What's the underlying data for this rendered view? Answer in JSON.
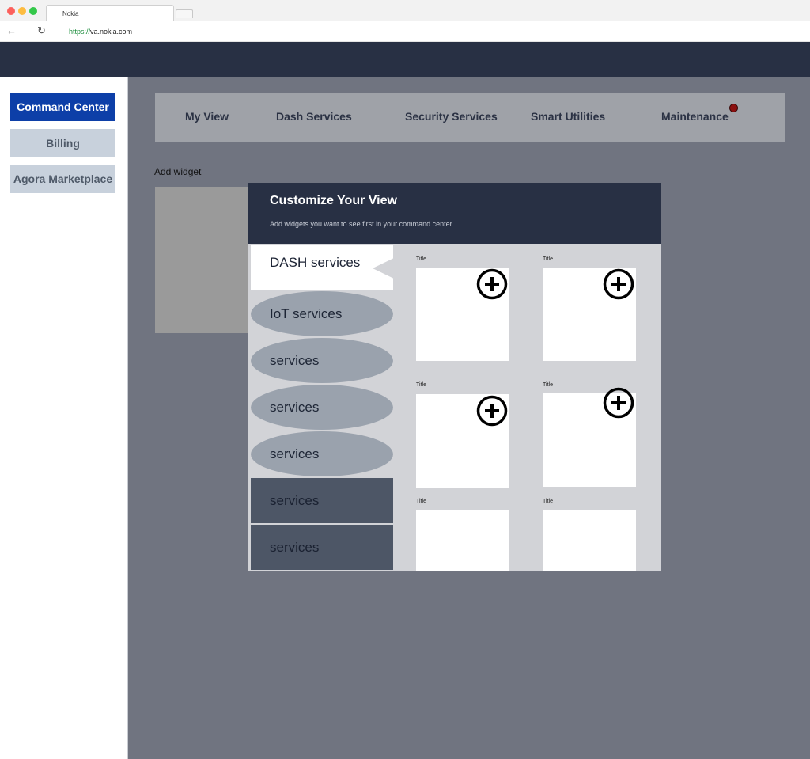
{
  "browser": {
    "tab_title": "Nokia",
    "url_scheme": "https://",
    "url_host": "va.nokia.com"
  },
  "sidebar": {
    "items": [
      {
        "label": "Command Center"
      },
      {
        "label": "Billing"
      },
      {
        "label": "Agora Marketplace"
      }
    ]
  },
  "topnav": {
    "items": [
      {
        "label": "My View"
      },
      {
        "label": "Dash Services"
      },
      {
        "label": "Security Services"
      },
      {
        "label": "Smart Utilities"
      },
      {
        "label": "Maintenance"
      }
    ]
  },
  "main": {
    "add_widget": "Add widget"
  },
  "modal": {
    "title": "Customize Your View",
    "subtitle": "Add widgets you want to see first in your command center",
    "categories": [
      {
        "label": "DASH services"
      },
      {
        "label": "IoT services"
      },
      {
        "label": "services"
      },
      {
        "label": "services"
      },
      {
        "label": "services"
      },
      {
        "label": "services"
      },
      {
        "label": "services"
      }
    ],
    "widgets": [
      {
        "title": "Title"
      },
      {
        "title": "Title"
      },
      {
        "title": "Title"
      },
      {
        "title": "Title"
      },
      {
        "title": "Title"
      },
      {
        "title": "Title"
      }
    ]
  },
  "colors": {
    "header": "#283044",
    "accent": "#0d3fa8",
    "notification": "#8b1010"
  }
}
